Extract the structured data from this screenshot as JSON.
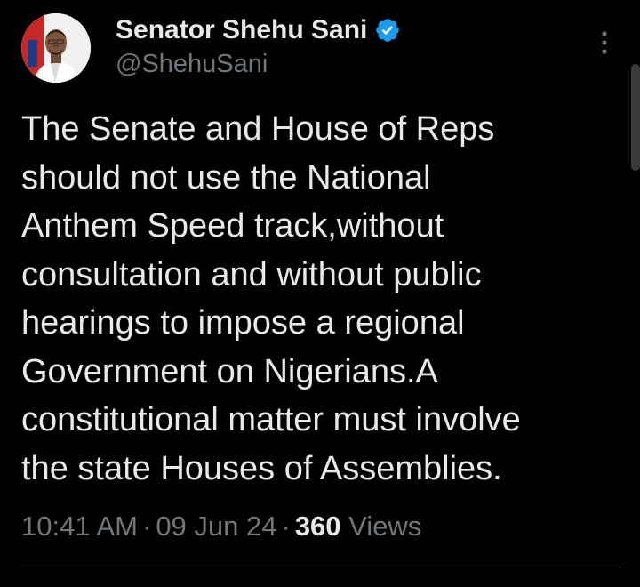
{
  "author": {
    "display_name": "Senator Shehu Sani",
    "handle": "@ShehuSani",
    "verified_icon": "verified-badge-icon",
    "avatar": "profile-photo"
  },
  "tweet": {
    "text_lines": [
      "The Senate and House of Reps",
      "should not use the National",
      "Anthem Speed track,without",
      "consultation and without public",
      "hearings to impose a regional",
      "Government on Nigerians.A",
      "constitutional matter must involve",
      "the state Houses of Assemblies."
    ]
  },
  "meta": {
    "time": "10:41 AM",
    "separator": "·",
    "date": "09 Jun 24",
    "views_count": "360",
    "views_label": "Views"
  },
  "controls": {
    "more_icon": "more-vertical-icon"
  },
  "colors": {
    "background": "#000000",
    "primary_text": "#e7e9ea",
    "secondary_text": "#71767b",
    "verified": "#1d9bf0",
    "divider": "#2f3336"
  }
}
